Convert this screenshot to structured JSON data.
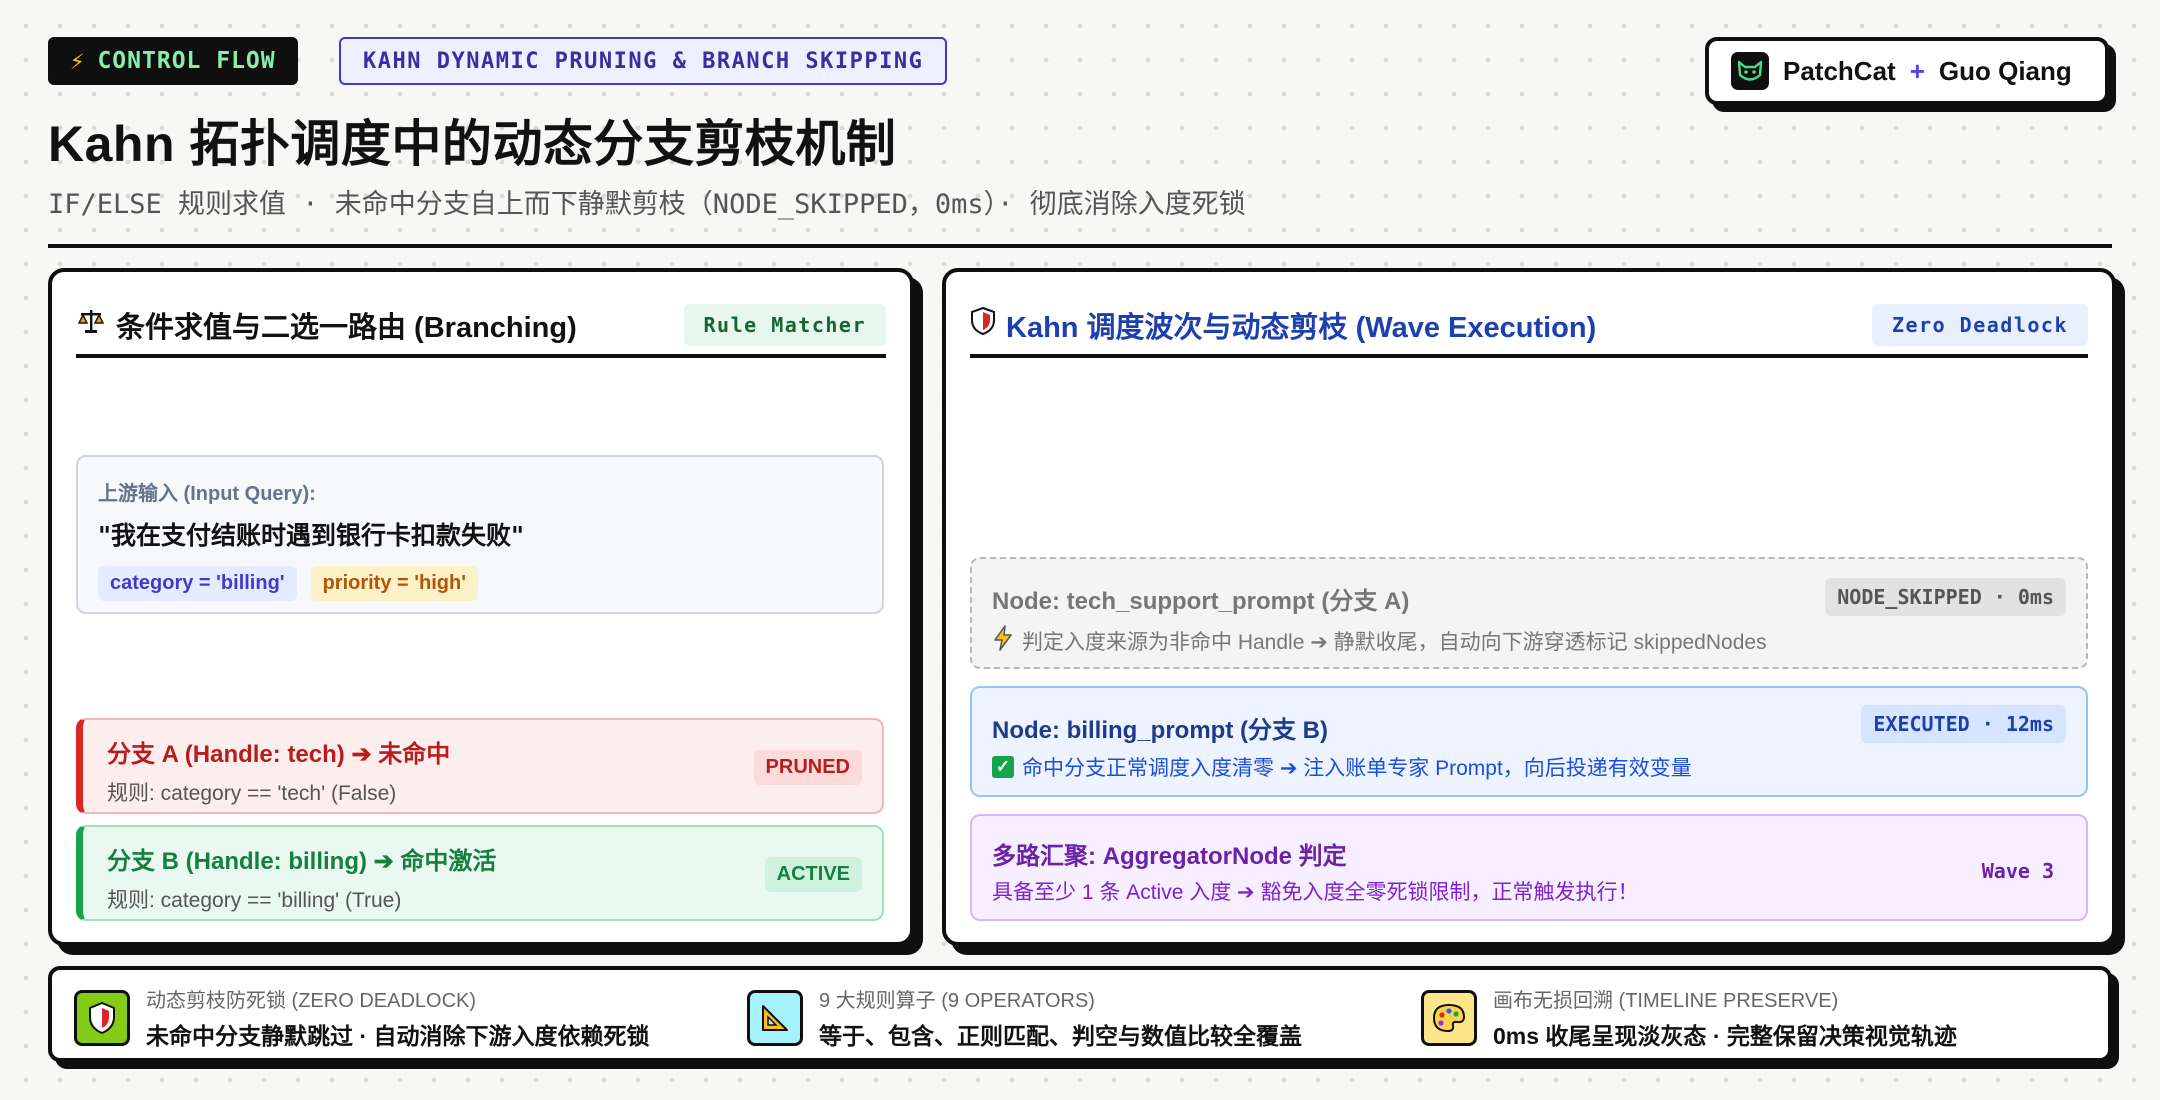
{
  "header": {
    "tag_flow": "CONTROL FLOW",
    "tag_pruning": "KAHN DYNAMIC PRUNING & BRANCH SKIPPING",
    "brand_a": "PatchCat",
    "brand_plus": "+",
    "brand_b": "Guo Qiang",
    "title": "Kahn 拓扑调度中的动态分支剪枝机制",
    "subtitle": "IF/ELSE 规则求值 · 未命中分支自上而下静默剪枝（NODE_SKIPPED，0ms）· 彻底消除入度死锁"
  },
  "left_panel": {
    "title": "条件求值与二选一路由 (Branching)",
    "badge": "Rule Matcher",
    "input": {
      "label": "上游输入 (Input Query):",
      "query": "\"我在支付结账时遇到银行卡扣款失败\"",
      "chip_category": "category = 'billing'",
      "chip_priority": "priority = 'high'"
    },
    "branches": [
      {
        "title": "分支 A (Handle: tech) ➔ 未命中",
        "rule": "规则: category == 'tech' (False)",
        "badge": "PRUNED"
      },
      {
        "title": "分支 B (Handle: billing) ➔ 命中激活",
        "rule": "规则: category == 'billing' (True)",
        "badge": "ACTIVE"
      }
    ]
  },
  "right_panel": {
    "title": "Kahn 调度波次与动态剪枝 (Wave Execution)",
    "badge": "Zero Deadlock",
    "nodes": [
      {
        "title": "Node: tech_support_prompt (分支 A)",
        "badge": "NODE_SKIPPED · 0ms",
        "desc": "判定入度来源为非命中 Handle ➔ 静默收尾，自动向下游穿透标记 skippedNodes",
        "icon": "lightning-icon"
      },
      {
        "title": "Node: billing_prompt (分支 B)",
        "badge": "EXECUTED · 12ms",
        "desc": "命中分支正常调度入度清零 ➔ 注入账单专家 Prompt，向后投递有效变量",
        "icon": "check-icon"
      },
      {
        "title": "多路汇聚: AggregatorNode 判定",
        "badge": "Wave 3",
        "desc": "具备至少 1 条 Active 入度 ➔ 豁免入度全零死锁限制，正常触发执行！"
      }
    ]
  },
  "footer": {
    "features": [
      {
        "label": "动态剪枝防死锁 (ZERO DEADLOCK)",
        "text": "未命中分支静默跳过 · 自动消除下游入度依赖死锁",
        "icon": "shield-icon",
        "color": "#84cc16"
      },
      {
        "label": "9 大规则算子 (9 OPERATORS)",
        "text": "等于、包含、正则匹配、判空与数值比较全覆盖",
        "icon": "triangle-ruler-icon",
        "color": "#a5f3fc"
      },
      {
        "label": "画布无损回溯 (TIMELINE PRESERVE)",
        "text": "0ms 收尾呈现淡灰态 · 完整保留决策视觉轨迹",
        "icon": "palette-icon",
        "color": "#fde68a"
      }
    ]
  },
  "colors": {
    "ink": "#0f0f0f",
    "pruned": "#dc2626",
    "active": "#16a34a",
    "executed": "#1e40af",
    "aggregator": "#6b21a8",
    "accent": "#4338ca"
  }
}
